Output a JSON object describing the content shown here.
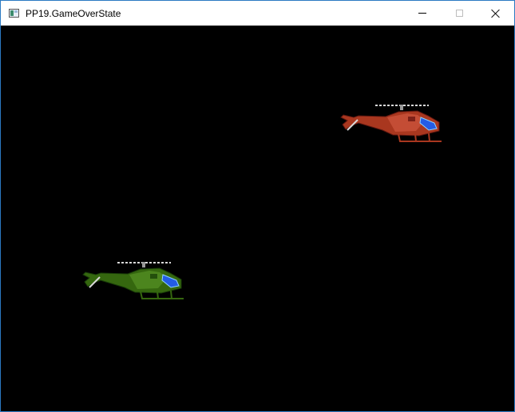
{
  "window": {
    "title": "PP19.GameOverState"
  },
  "icons": {
    "app": "window-app-icon",
    "minimize": "minimize-icon",
    "maximize": "maximize-icon",
    "close": "close-icon"
  },
  "game": {
    "sprites": [
      {
        "name": "enemy-helicopter",
        "color": "#b7432e",
        "sprite": "red-helicopter"
      },
      {
        "name": "player-helicopter",
        "color": "#3f7f18",
        "sprite": "green-helicopter"
      }
    ]
  }
}
